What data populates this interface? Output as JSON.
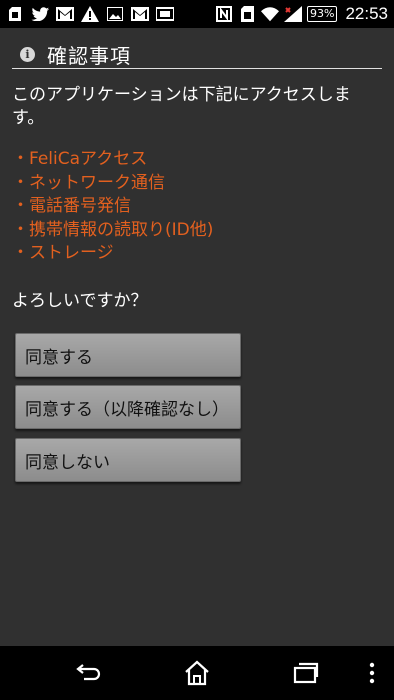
{
  "status_bar": {
    "battery": "93%",
    "time": "22:53",
    "icons_left": [
      "sd-card-icon",
      "twitter-icon",
      "gmail-icon",
      "warning-icon",
      "image-icon",
      "gmail-icon",
      "card-icon"
    ],
    "icons_right": [
      "nfc-icon",
      "sim-icon",
      "wifi-icon",
      "signal-icon"
    ]
  },
  "dialog": {
    "title": "確認事項",
    "message": "このアプリケーションは下記にアクセスします。",
    "permissions": [
      "・FeliCaアクセス",
      "・ネットワーク通信",
      "・電話番号発信",
      "・携帯情報の読取り(ID他)",
      "・ストレージ"
    ],
    "question": "よろしいですか？",
    "buttons": {
      "agree": "同意する",
      "agree_no_confirm": "同意する（以降確認なし）",
      "disagree": "同意しない"
    }
  },
  "colors": {
    "dialog_bg": "#303030",
    "permission_text": "#e2601f",
    "button_bg": "#999999"
  },
  "nav_bar": {
    "icons": [
      "back-icon",
      "home-icon",
      "recents-icon",
      "menu-icon"
    ]
  }
}
